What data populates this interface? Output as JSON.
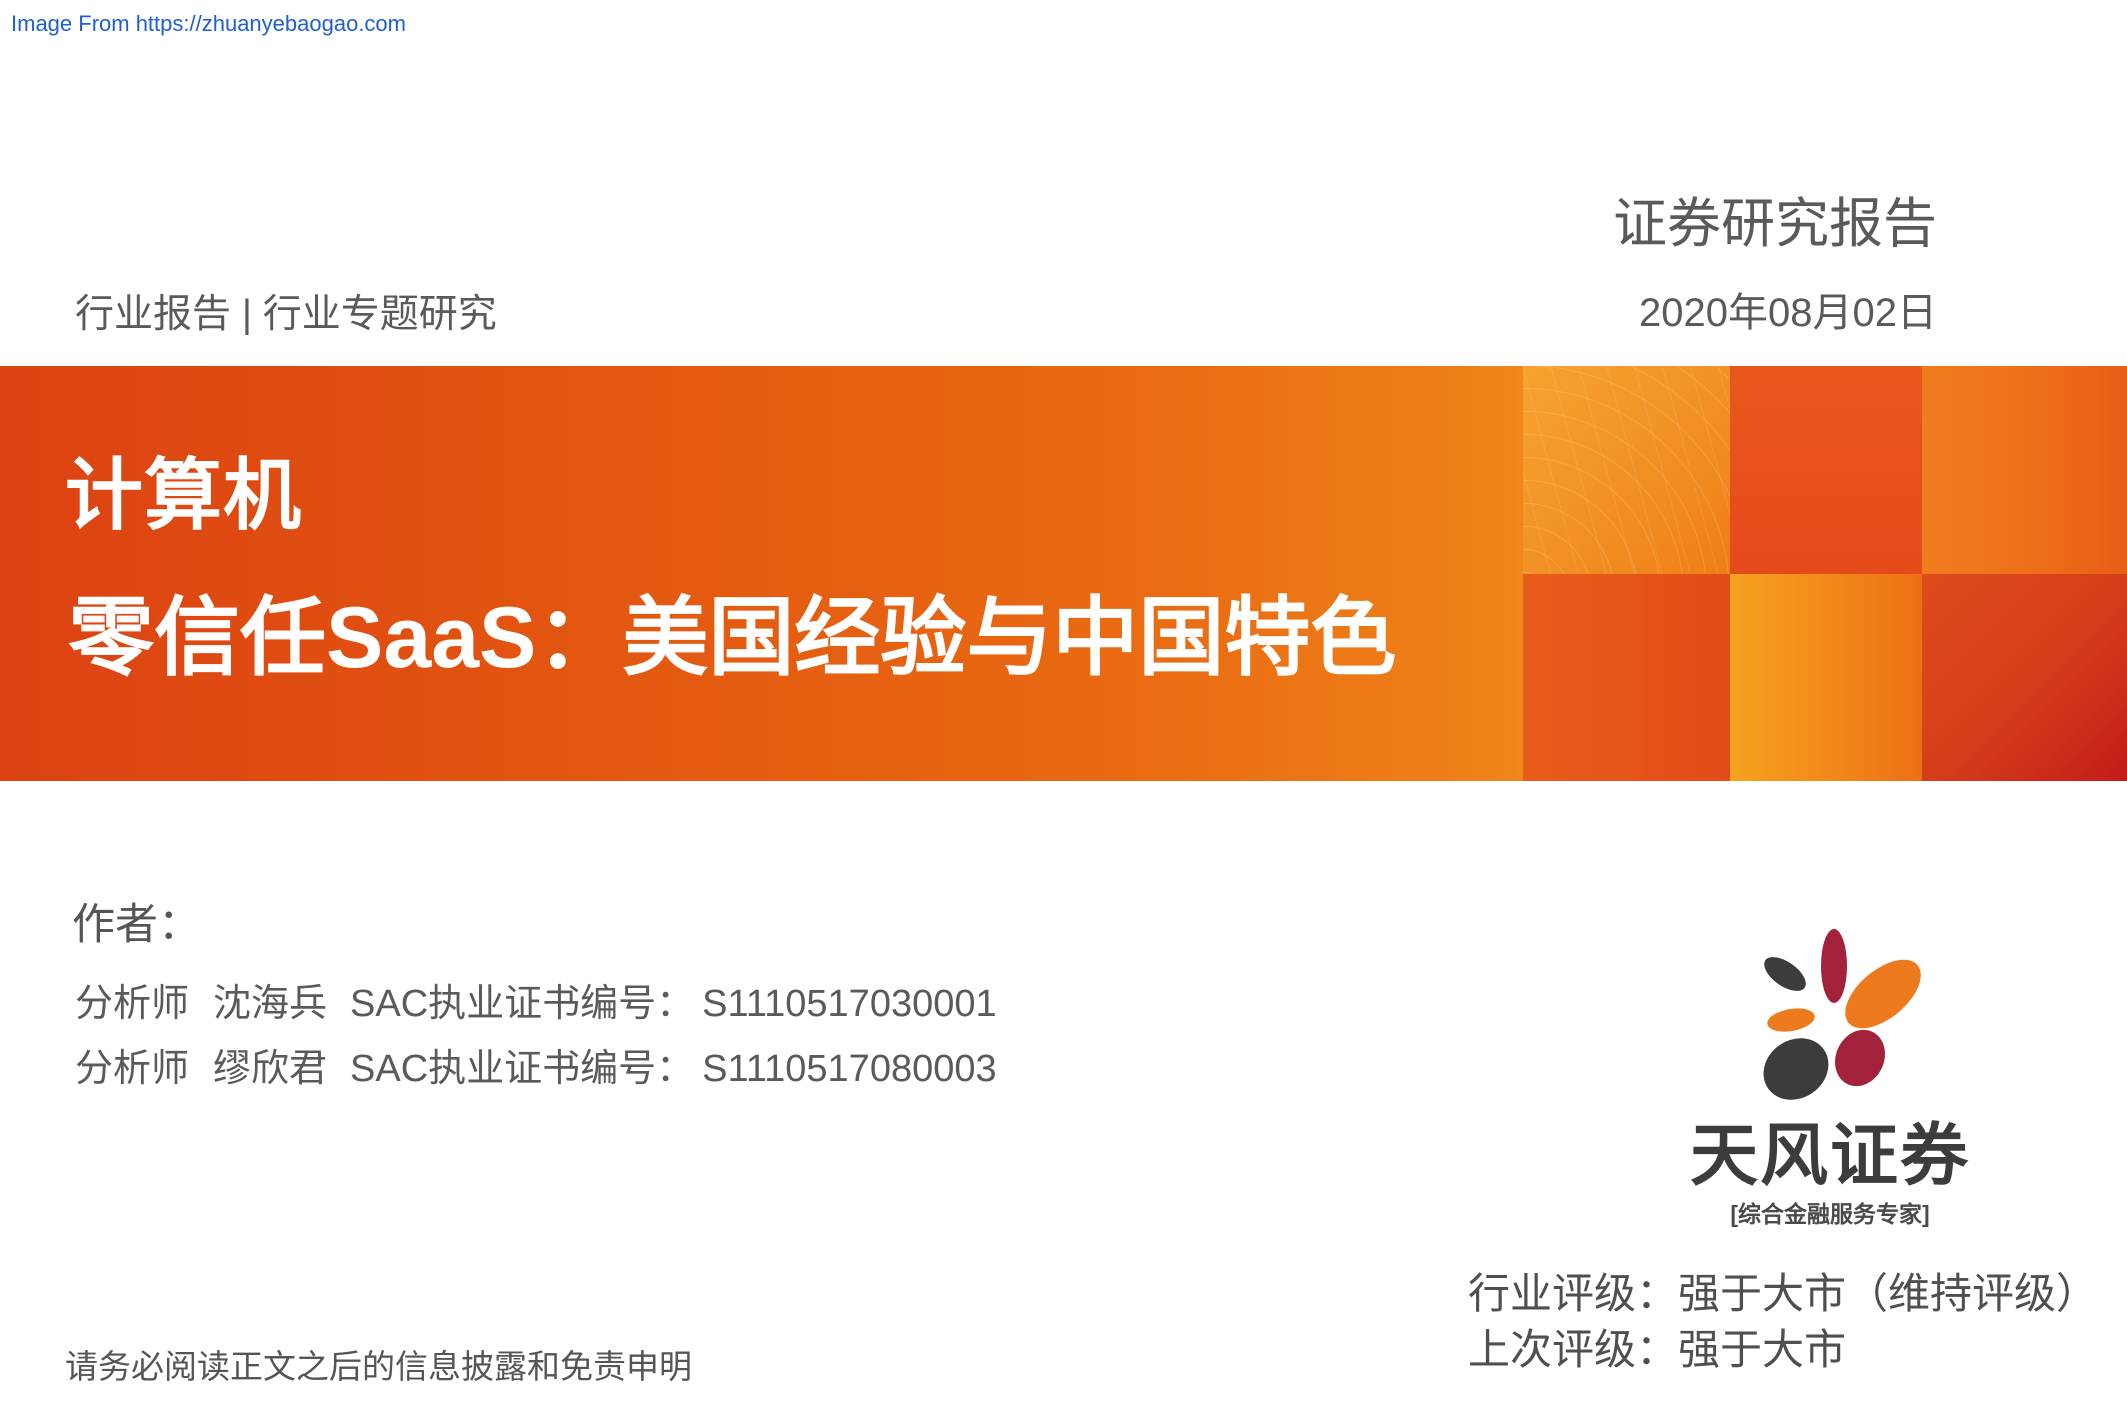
{
  "watermark": "Image From https://zhuanyebaogao.com",
  "header": {
    "report_type": "证券研究报告",
    "date": "2020年08月02日",
    "category": "行业报告 | 行业专题研究"
  },
  "banner": {
    "industry": "计算机",
    "title": "零信任SaaS：美国经验与中国特色"
  },
  "authors": {
    "label": "作者：",
    "list": [
      {
        "role": "分析师",
        "name": "沈海兵",
        "cert_label": "SAC执业证书编号：",
        "cert_no": "S1110517030001"
      },
      {
        "role": "分析师",
        "name": "缪欣君",
        "cert_label": "SAC执业证书编号：",
        "cert_no": "S1110517080003"
      }
    ]
  },
  "logo": {
    "name": "天风证券",
    "slogan": "[综合金融服务专家]"
  },
  "rating": {
    "current": "行业评级：强于大市（维持评级）",
    "previous": "上次评级：强于大市"
  },
  "disclaimer": "请务必阅读正文之后的信息披露和免责申明",
  "colors": {
    "text_gray": "#565656",
    "link_blue": "#1f5fd1",
    "banner_orange": "#e8641a",
    "logo_maroon": "#a3213a",
    "logo_orange": "#ee7a1e",
    "logo_gray": "#3c3c3c"
  }
}
